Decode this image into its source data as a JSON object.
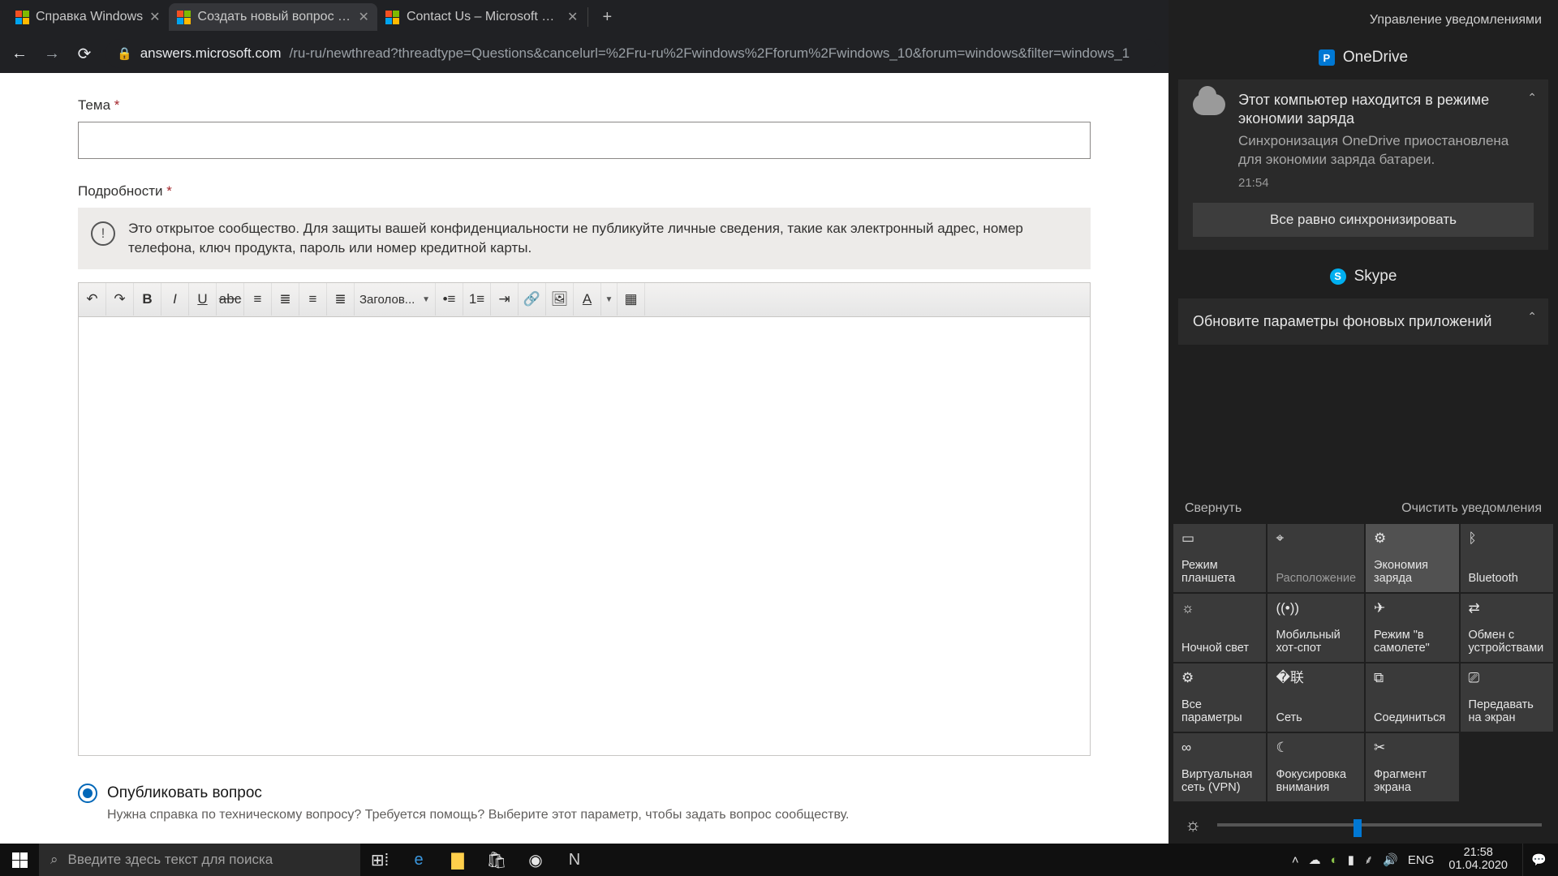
{
  "browser": {
    "tabs": [
      {
        "title": "Справка Windows"
      },
      {
        "title": "Создать новый вопрос или нач"
      },
      {
        "title": "Contact Us – Microsoft Support"
      }
    ],
    "url_host": "answers.microsoft.com",
    "url_path": "/ru-ru/newthread?threadtype=Questions&cancelurl=%2Fru-ru%2Fwindows%2Fforum%2Fwindows_10&forum=windows&filter=windows_1"
  },
  "form": {
    "subject_label": "Тема",
    "details_label": "Подробности",
    "info_text": "Это открытое сообщество. Для защиты вашей конфиденциальности не публикуйте личные сведения, такие как электронный адрес, номер телефона, ключ продукта, пароль или номер кредитной карты.",
    "heading_dropdown": "Заголов...",
    "publish_label": "Опубликовать вопрос",
    "publish_help": "Нужна справка по техническому вопросу? Требуется помощь? Выберите этот параметр, чтобы задать вопрос сообществу."
  },
  "ac": {
    "manage": "Управление уведомлениями",
    "onedrive": {
      "group": "OneDrive",
      "title": "Этот компьютер находится в режиме экономии заряда",
      "sub": "Синхронизация OneDrive приостановлена для экономии заряда батареи.",
      "time": "21:54",
      "action": "Все равно синхронизировать"
    },
    "skype": {
      "group": "Skype",
      "title": "Обновите параметры фоновых приложений"
    },
    "collapse": "Свернуть",
    "clear": "Очистить уведомления",
    "tiles": [
      "Режим планшета",
      "Расположение",
      "Экономия заряда",
      "Bluetooth",
      "Ночной свет",
      "Мобильный хот-спот",
      "Режим \"в самолете\"",
      "Обмен с устройствами",
      "Все параметры",
      "Сеть",
      "Соединиться",
      "Передавать на экран",
      "Виртуальная сеть (VPN)",
      "Фокусировка внимания",
      "Фрагмент экрана",
      ""
    ]
  },
  "taskbar": {
    "search_placeholder": "Введите здесь текст для поиска",
    "lang": "ENG",
    "time": "21:58",
    "date": "01.04.2020"
  }
}
